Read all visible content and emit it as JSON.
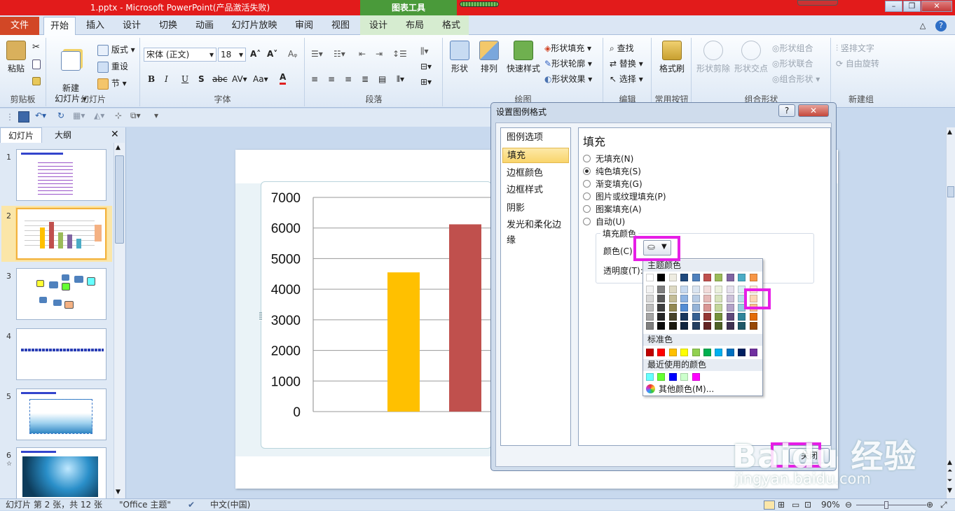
{
  "window": {
    "title": "1.pptx - Microsoft PowerPoint(产品激活失败)",
    "context_title": "图表工具"
  },
  "tabs": [
    {
      "label": "文件"
    },
    {
      "label": "开始"
    },
    {
      "label": "插入"
    },
    {
      "label": "设计"
    },
    {
      "label": "切换"
    },
    {
      "label": "动画"
    },
    {
      "label": "幻灯片放映"
    },
    {
      "label": "审阅"
    },
    {
      "label": "视图"
    },
    {
      "label": "设计"
    },
    {
      "label": "布局"
    },
    {
      "label": "格式"
    }
  ],
  "ribbon": {
    "clipboard": {
      "label": "剪贴板",
      "paste": "粘贴"
    },
    "slides": {
      "label": "幻灯片",
      "new_slide": "新建\n幻灯片 ▾",
      "layout": "版式 ▾",
      "reset": "重设",
      "section": "节 ▾"
    },
    "font": {
      "label": "字体",
      "font_name": "宋体 (正文)",
      "font_size": "18"
    },
    "paragraph": {
      "label": "段落"
    },
    "drawing": {
      "label": "绘图",
      "shape": "形状",
      "arrange": "排列",
      "quick_styles": "快速样式",
      "shape_fill": "形状填充 ▾",
      "shape_outline": "形状轮廓 ▾",
      "shape_effect": "形状效果 ▾"
    },
    "editing": {
      "label": "编辑",
      "find": "查找",
      "replace": "替换 ▾",
      "select": "选择 ▾"
    },
    "common": {
      "label": "常用按钮",
      "format_painter": "格式刷"
    },
    "combine": {
      "label": "组合形状",
      "shape_subtract": "形状剪除",
      "shape_intersect": "形状交点",
      "shape_combine": "形状组合",
      "shape_union": "形状联合",
      "combine_shape": "组合形状 ▾"
    },
    "newgroup": {
      "label": "新建组",
      "vertical_text": "竖排文字",
      "free_rotate": "自由旋转"
    }
  },
  "left_pane": {
    "tab_slides": "幻灯片",
    "tab_outline": "大纲",
    "slide_numbers": [
      "1",
      "2",
      "3",
      "4",
      "5",
      "6"
    ]
  },
  "chart_data": {
    "type": "bar",
    "categories": [
      "",
      "",
      ""
    ],
    "values": [
      4550,
      6120,
      0
    ],
    "ylim": [
      0,
      7000
    ],
    "yticks": [
      "7000",
      "6000",
      "5000",
      "4000",
      "3000",
      "2000",
      "1000",
      "0"
    ],
    "colors": [
      "#ffc000",
      "#c0504d"
    ],
    "grid": true
  },
  "dialog": {
    "title": "设置图例格式",
    "help": "?",
    "close": "✕",
    "nav": [
      "图例选项",
      "填充",
      "边框颜色",
      "边框样式",
      "阴影",
      "发光和柔化边缘"
    ],
    "panel_title": "填充",
    "options": [
      "无填充(N)",
      "纯色填充(S)",
      "渐变填充(G)",
      "图片或纹理填充(P)",
      "图案填充(A)",
      "自动(U)"
    ],
    "fill_color_group": "填充颜色",
    "color_label": "颜色(C):",
    "transparency_label": "透明度(T):",
    "close_button": "关闭"
  },
  "picker": {
    "theme_label": "主题颜色",
    "standard_label": "标准色",
    "recent_label": "最近使用的颜色",
    "more_colors": "其他颜色(M)...",
    "theme_top": [
      "#ffffff",
      "#000000",
      "#eeece1",
      "#1f497d",
      "#4f81bd",
      "#c0504d",
      "#9bbb59",
      "#8064a2",
      "#4bacc6",
      "#f79646"
    ],
    "theme_cols": [
      [
        "#f2f2f2",
        "#d8d8d8",
        "#bfbfbf",
        "#a5a5a5",
        "#7f7f7f"
      ],
      [
        "#7f7f7f",
        "#595959",
        "#3f3f3f",
        "#262626",
        "#0c0c0c"
      ],
      [
        "#ddd9c3",
        "#c4bd97",
        "#938953",
        "#494429",
        "#1d1b10"
      ],
      [
        "#c6d9f0",
        "#8db3e2",
        "#548dd4",
        "#17365d",
        "#0f243e"
      ],
      [
        "#dbe5f1",
        "#b8cce4",
        "#95b3d7",
        "#366092",
        "#244061"
      ],
      [
        "#f2dcdb",
        "#e5b9b7",
        "#d99694",
        "#953734",
        "#632423"
      ],
      [
        "#ebf1dd",
        "#d7e3bc",
        "#c3d69b",
        "#76923c",
        "#4f6128"
      ],
      [
        "#e5e0ec",
        "#ccc1d9",
        "#b2a2c7",
        "#5f497a",
        "#3f3151"
      ],
      [
        "#dbeef3",
        "#b7dde8",
        "#92cddc",
        "#31859b",
        "#205867"
      ],
      [
        "#fdeada",
        "#fbd5b5",
        "#fac08f",
        "#e36c09",
        "#974806"
      ]
    ],
    "standard": [
      "#c00000",
      "#ff0000",
      "#ffc000",
      "#ffff00",
      "#92d050",
      "#00b050",
      "#00b0f0",
      "#0070c0",
      "#002060",
      "#7030a0"
    ],
    "recent": [
      "#66ffff",
      "#66ff33",
      "#0000ff",
      "#ccffcc",
      "#ff00ff"
    ]
  },
  "statusbar": {
    "slide_info": "幻灯片 第 2 张，共 12 张",
    "theme": "\"Office 主题\"",
    "language": "中文(中国)",
    "zoom": "90%"
  },
  "watermark": {
    "brand": "Baidu 经验",
    "url": "jingyan.baidu.com"
  }
}
